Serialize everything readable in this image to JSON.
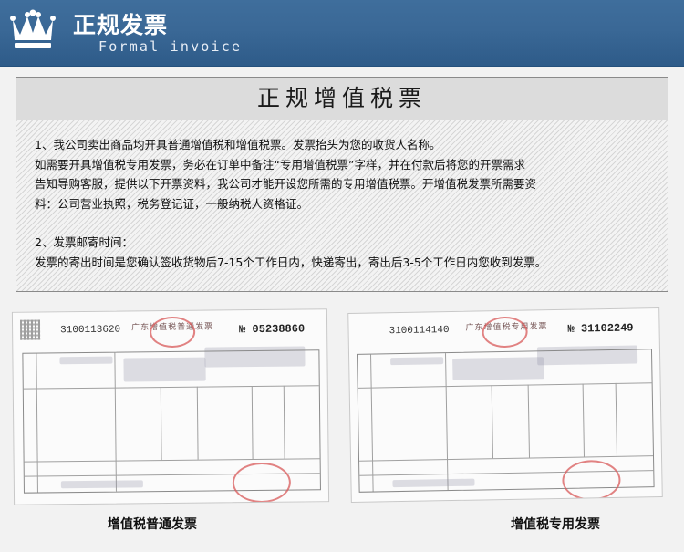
{
  "header": {
    "title": "正规发票",
    "subtitle": "Formal invoice",
    "logo_icon": "crown-icon"
  },
  "info": {
    "title": "正规增值税票",
    "paragraphs": [
      "1、我公司卖出商品均开具普通增值税和增值税票。发票抬头为您的收货人名称。",
      "如需要开具增值税专用发票，务必在订单中备注“专用增值税票”字样，并在付款后将您的开票需求",
      "告知导购客服，提供以下开票资料，我公司才能开设您所需的专用增值税票。开增值税发票所需要资",
      "料：公司营业执照，税务登记证，一般纳税人资格证。",
      "2、发票邮寄时间：",
      "发票的寄出时间是您确认签收货物后7-15个工作日内，快递寄出，寄出后3-5个工作日内您收到发票。"
    ]
  },
  "invoices": [
    {
      "code": "3100113620",
      "title": "广东增值税普通发票",
      "number_label": "№",
      "number": "05238860",
      "caption": "增值税普通发票"
    },
    {
      "code": "3100114140",
      "title": "广东增值税专用发票",
      "number_label": "№",
      "number": "31102249",
      "caption": "增值税专用发票"
    }
  ],
  "colors": {
    "header_bg": "#3a6896",
    "stamp_red": "#d85a5a"
  }
}
